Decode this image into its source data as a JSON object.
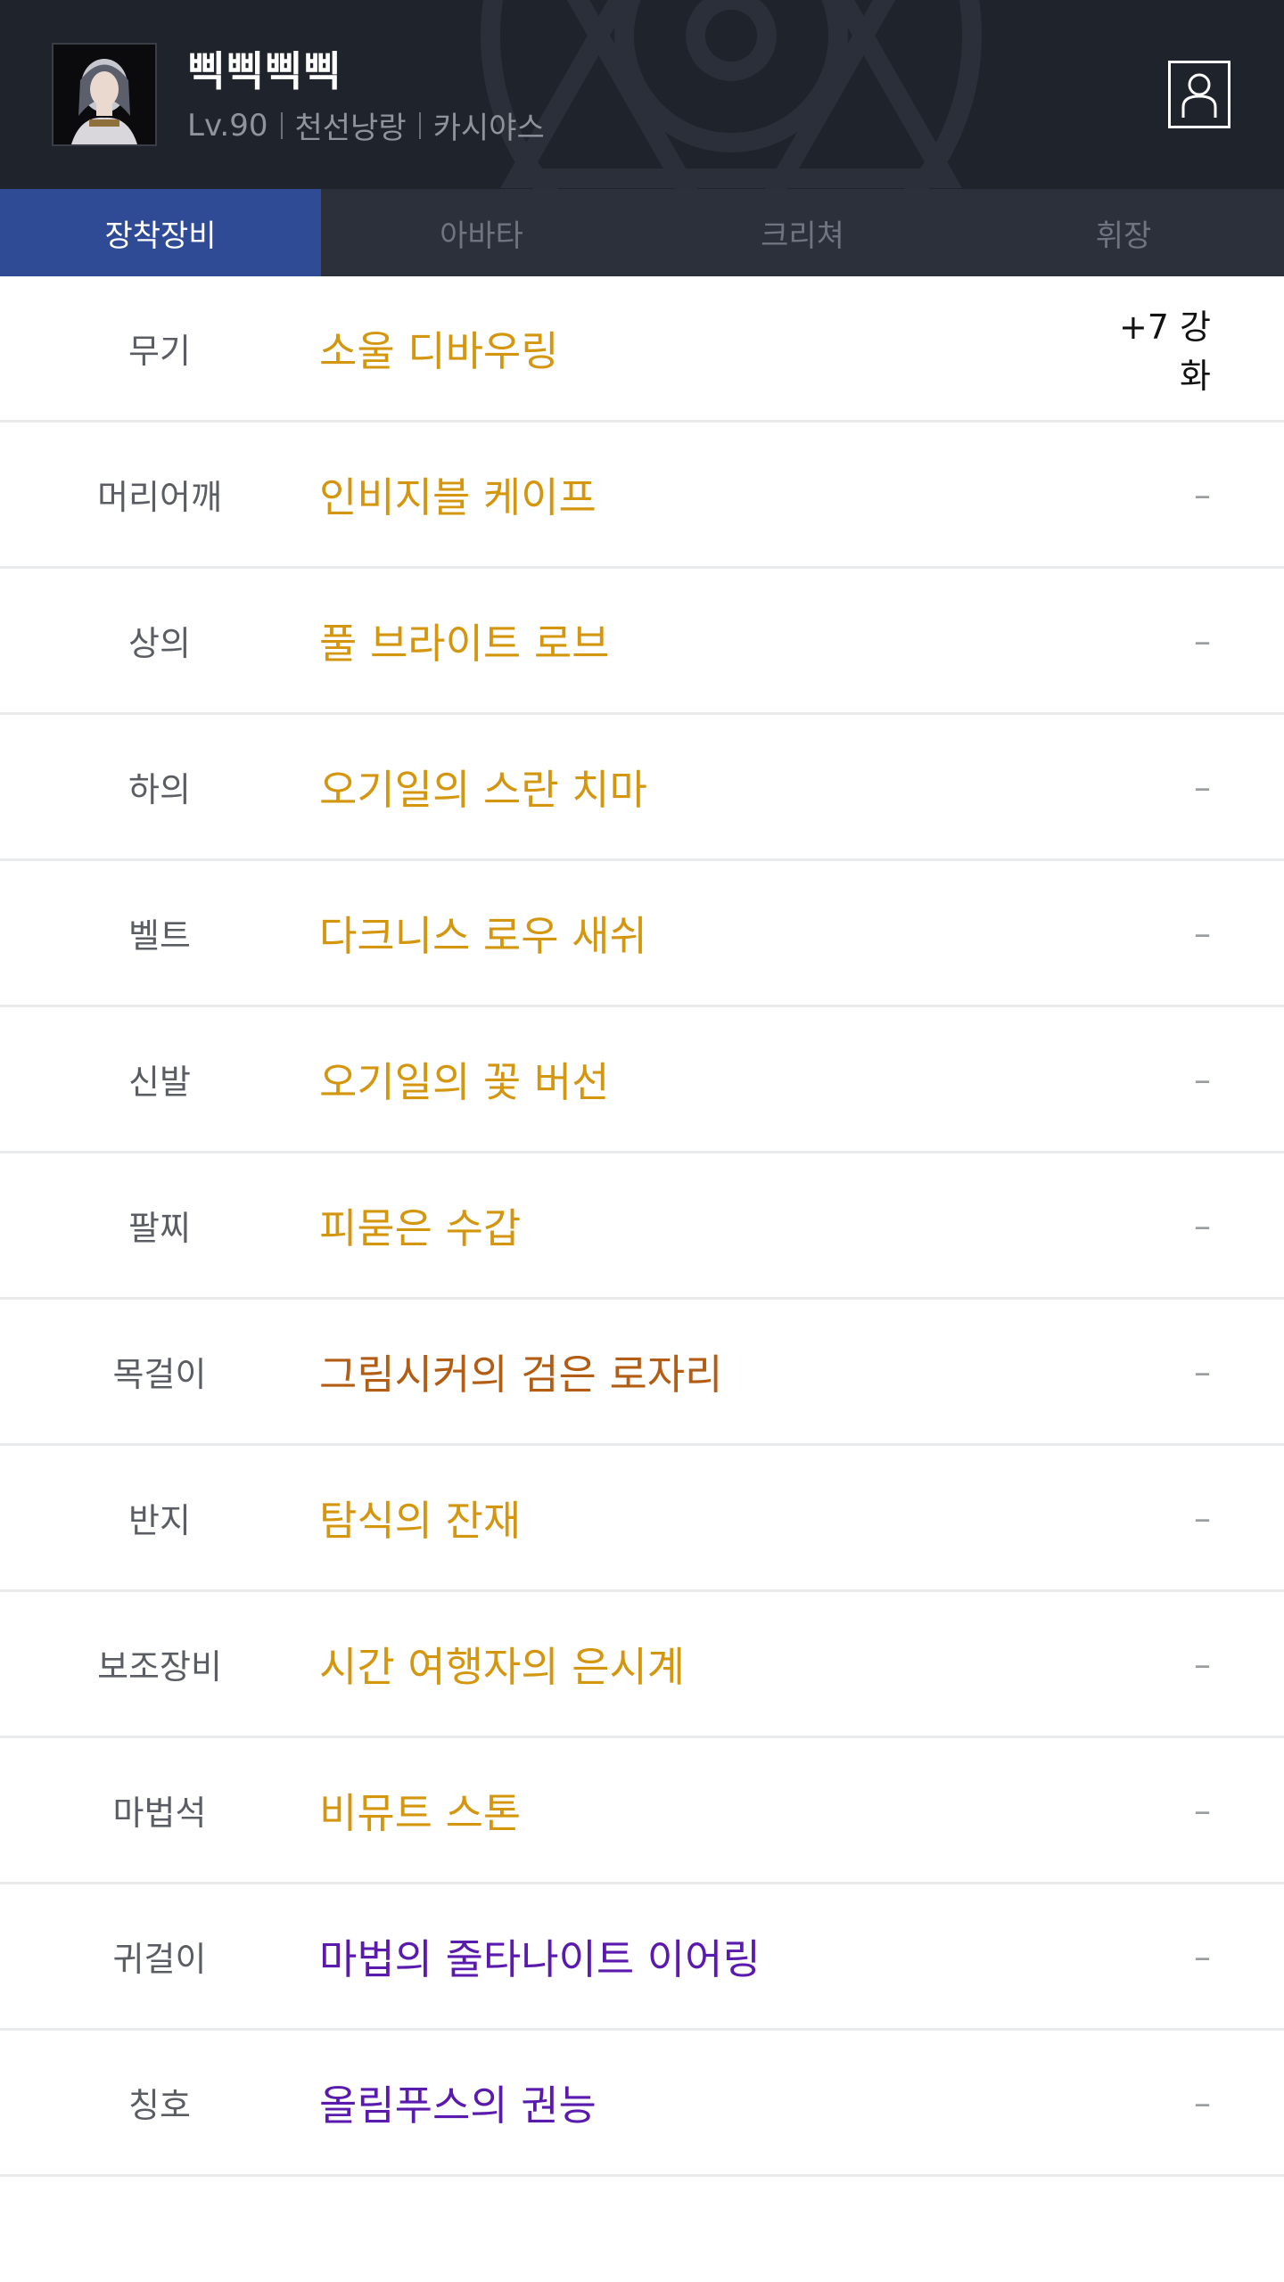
{
  "character": {
    "name": "삑삑삑삑",
    "level": "Lv.90",
    "class": "천선낭랑",
    "server": "카시야스"
  },
  "tabs": [
    {
      "label": "장착장비",
      "active": true
    },
    {
      "label": "아바타",
      "active": false
    },
    {
      "label": "크리쳐",
      "active": false
    },
    {
      "label": "휘장",
      "active": false
    }
  ],
  "equipment": [
    {
      "slot": "무기",
      "item": "소울 디바우링",
      "enhance": "+7 강화",
      "rarity": "legendary"
    },
    {
      "slot": "머리어깨",
      "item": "인비지블 케이프",
      "enhance": "–",
      "rarity": "legendary"
    },
    {
      "slot": "상의",
      "item": "풀 브라이트 로브",
      "enhance": "–",
      "rarity": "legendary"
    },
    {
      "slot": "하의",
      "item": "오기일의 스란 치마",
      "enhance": "–",
      "rarity": "legendary"
    },
    {
      "slot": "벨트",
      "item": "다크니스 로우 새쉬",
      "enhance": "–",
      "rarity": "legendary"
    },
    {
      "slot": "신발",
      "item": "오기일의 꽃 버선",
      "enhance": "–",
      "rarity": "legendary"
    },
    {
      "slot": "팔찌",
      "item": "피묻은 수갑",
      "enhance": "–",
      "rarity": "legendary"
    },
    {
      "slot": "목걸이",
      "item": "그림시커의 검은 로자리",
      "enhance": "–",
      "rarity": "epic"
    },
    {
      "slot": "반지",
      "item": "탐식의 잔재",
      "enhance": "–",
      "rarity": "legendary"
    },
    {
      "slot": "보조장비",
      "item": "시간 여행자의 은시계",
      "enhance": "–",
      "rarity": "legendary"
    },
    {
      "slot": "마법석",
      "item": "비뮤트 스톤",
      "enhance": "–",
      "rarity": "legendary"
    },
    {
      "slot": "귀걸이",
      "item": "마법의 줄타나이트 이어링",
      "enhance": "–",
      "rarity": "unique"
    },
    {
      "slot": "칭호",
      "item": "올림푸스의 권능",
      "enhance": "–",
      "rarity": "unique"
    }
  ],
  "colors": {
    "header_bg": "#1f232c",
    "tab_bar_bg": "#2b303b",
    "tab_active_bg": "#2f4b95",
    "item_legendary": "#d5960f",
    "item_epic": "#b35c14",
    "item_unique": "#5a1aae"
  },
  "icons": {
    "profile": "profile-card-icon",
    "avatar": "character-avatar-image"
  }
}
